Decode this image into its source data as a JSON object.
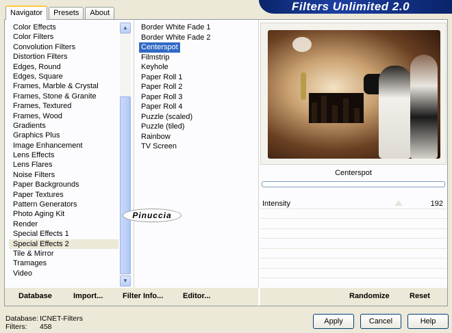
{
  "tabs": [
    {
      "label": "Navigator",
      "active": true
    },
    {
      "label": "Presets",
      "active": false
    },
    {
      "label": "About",
      "active": false
    }
  ],
  "banner": {
    "title": "Filters Unlimited 2.0"
  },
  "categories": [
    "Color Effects",
    "Color Filters",
    "Convolution Filters",
    "Distortion Filters",
    "Edges, Round",
    "Edges, Square",
    "Frames, Marble & Crystal",
    "Frames, Stone & Granite",
    "Frames, Textured",
    "Frames, Wood",
    "Gradients",
    "Graphics Plus",
    "Image Enhancement",
    "Lens Effects",
    "Lens Flares",
    "Noise Filters",
    "Paper Backgrounds",
    "Paper Textures",
    "Pattern Generators",
    "Photo Aging Kit",
    "Render",
    "Special Effects 1",
    "Special Effects 2",
    "Tile & Mirror",
    "Tramages",
    "Video"
  ],
  "selected_category": "Special Effects 2",
  "filters": [
    "Border White Fade 1",
    "Border White Fade 2",
    "Centerspot",
    "Filmstrip",
    "Keyhole",
    "Paper Roll 1",
    "Paper Roll 2",
    "Paper Roll 3",
    "Paper Roll 4",
    "Puzzle (scaled)",
    "Puzzle (tiled)",
    "Rainbow",
    "TV Screen"
  ],
  "selected_filter": "Centerspot",
  "watermark": "Pinuccia",
  "preview": {
    "label": "Centerspot"
  },
  "params": [
    {
      "name": "Intensity",
      "value": "192"
    }
  ],
  "bottom_left": {
    "database": "Database",
    "import": "Import...",
    "filter_info": "Filter Info...",
    "editor": "Editor..."
  },
  "bottom_right": {
    "randomize": "Randomize",
    "reset": "Reset"
  },
  "status": {
    "database_label": "Database:",
    "database_value": "ICNET-Filters",
    "filters_label": "Filters:",
    "filters_value": "458"
  },
  "buttons": {
    "apply": "Apply",
    "cancel": "Cancel",
    "help": "Help"
  },
  "colors": {
    "selection": "#316ac5",
    "banner": "#0a246a",
    "tab_highlight": "#ffc83c"
  }
}
